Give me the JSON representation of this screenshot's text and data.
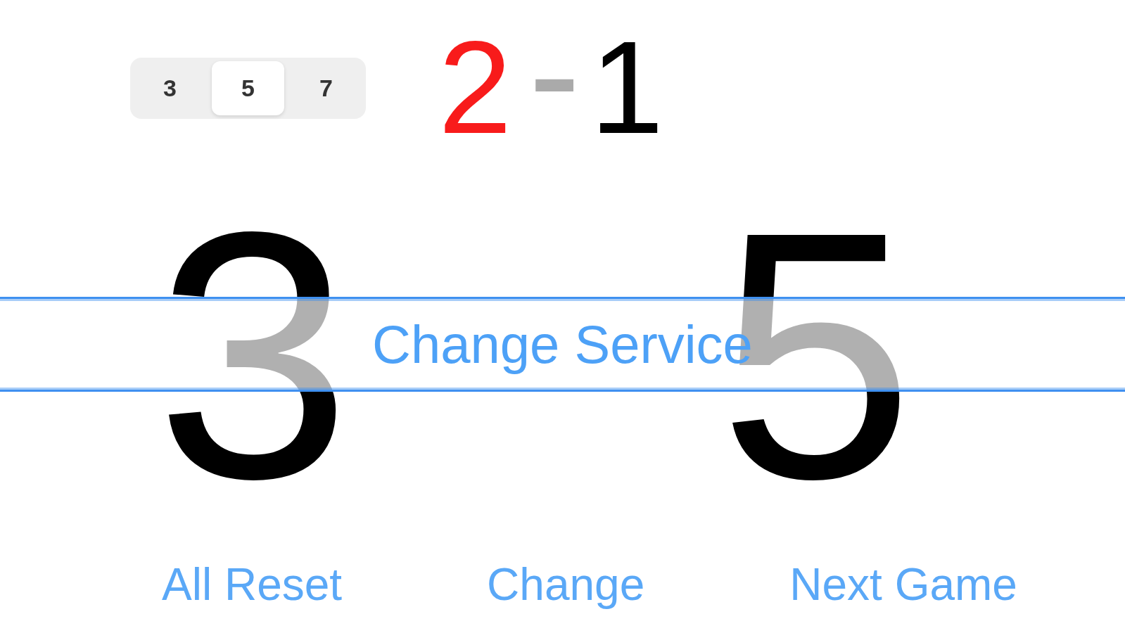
{
  "best_of": [
    {
      "label": "3",
      "selected": false
    },
    {
      "label": "5",
      "selected": true
    },
    {
      "label": "7",
      "selected": false
    }
  ],
  "game_score": {
    "games": [
      {
        "value": "2",
        "color": "#f81b1b"
      },
      {
        "value": "1",
        "color": "#000000"
      }
    ],
    "separator": "-"
  },
  "points": [
    {
      "value": "3"
    },
    {
      "value": "5"
    }
  ],
  "service_bar": {
    "label": "Change Service"
  },
  "buttons": [
    {
      "label": "All Reset"
    },
    {
      "label": "Change"
    },
    {
      "label": "Next Game"
    }
  ]
}
